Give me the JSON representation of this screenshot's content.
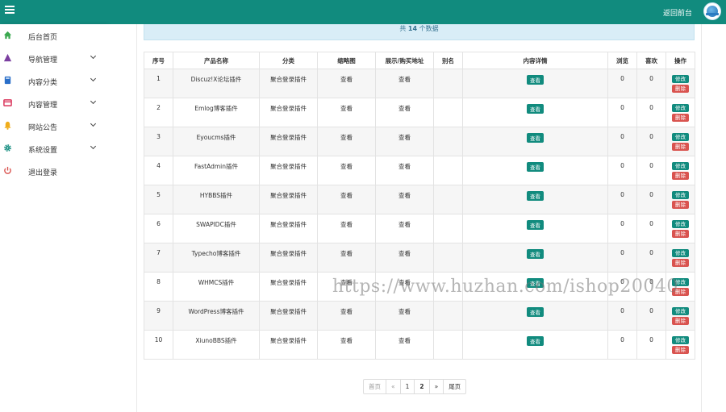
{
  "topbar": {
    "back_label": "返回前台",
    "accent": "#118b7e"
  },
  "sidebar": {
    "items": [
      {
        "label": "后台首页",
        "icon": "home-icon",
        "color": "#3aa84f"
      },
      {
        "label": "导航管理",
        "icon": "triangle-icon",
        "color": "#7b3fa0"
      },
      {
        "label": "内容分类",
        "icon": "book-icon",
        "color": "#2a6fc9"
      },
      {
        "label": "内容管理",
        "icon": "card-icon",
        "color": "#d9345a"
      },
      {
        "label": "网站公告",
        "icon": "bell-icon",
        "color": "#f0ad1b"
      },
      {
        "label": "系统设置",
        "icon": "gear-icon",
        "color": "#118b7e"
      },
      {
        "label": "退出登录",
        "icon": "power-icon",
        "color": "#d9534f"
      }
    ]
  },
  "info": {
    "prefix": "共",
    "count": "14",
    "suffix": "个数据"
  },
  "table": {
    "headers": [
      "序号",
      "产品名称",
      "分类",
      "缩略图",
      "展示/购买地址",
      "别名",
      "内容详情",
      "浏览",
      "喜欢",
      "操作"
    ],
    "view_label": "查看",
    "edit_label": "修改",
    "delete_label": "删除",
    "rows": [
      {
        "no": "1",
        "name": "Discuz!X论坛插件",
        "category": "聚合登录插件",
        "views": "0",
        "likes": "0"
      },
      {
        "no": "2",
        "name": "Emlog博客插件",
        "category": "聚合登录插件",
        "views": "0",
        "likes": "0"
      },
      {
        "no": "3",
        "name": "Eyoucms插件",
        "category": "聚合登录插件",
        "views": "0",
        "likes": "0"
      },
      {
        "no": "4",
        "name": "FastAdmin插件",
        "category": "聚合登录插件",
        "views": "0",
        "likes": "0"
      },
      {
        "no": "5",
        "name": "HYBBS插件",
        "category": "聚合登录插件",
        "views": "0",
        "likes": "0"
      },
      {
        "no": "6",
        "name": "SWAPIDC插件",
        "category": "聚合登录插件",
        "views": "0",
        "likes": "0"
      },
      {
        "no": "7",
        "name": "Typecho博客插件",
        "category": "聚合登录插件",
        "views": "0",
        "likes": "0"
      },
      {
        "no": "8",
        "name": "WHMCS插件",
        "category": "聚合登录插件",
        "views": "0",
        "likes": "0"
      },
      {
        "no": "9",
        "name": "WordPress博客插件",
        "category": "聚合登录插件",
        "views": "0",
        "likes": "0"
      },
      {
        "no": "10",
        "name": "XiunoBBS插件",
        "category": "聚合登录插件",
        "views": "0",
        "likes": "0"
      }
    ]
  },
  "pagination": {
    "first": "首页",
    "prev": "«",
    "pages": [
      "1",
      "2"
    ],
    "next": "»",
    "last": "尾页"
  },
  "watermark": "https://www.huzhan.com/ishop20040"
}
